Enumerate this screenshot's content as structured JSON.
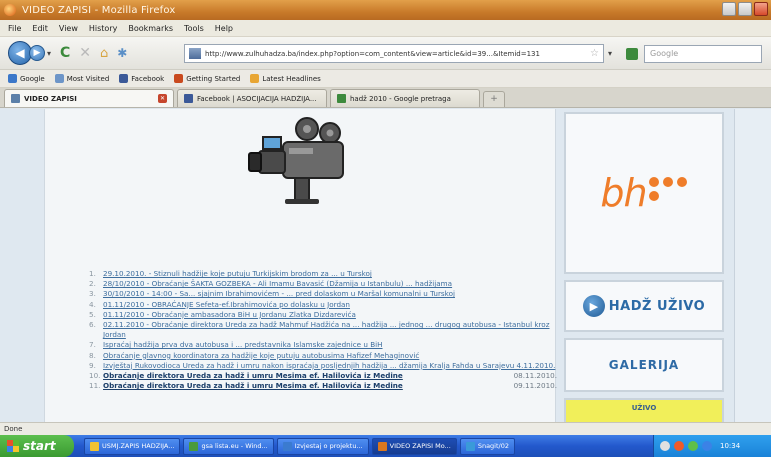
{
  "window": {
    "title": "VIDEO ZAPISI - Mozilla Firefox"
  },
  "menu": [
    "File",
    "Edit",
    "View",
    "History",
    "Bookmarks",
    "Tools",
    "Help"
  ],
  "nav": {
    "url": "http://www.zulhuhadza.ba/index.php?option=com_content&view=article&id=39...&Itemid=131",
    "search_placeholder": "Google"
  },
  "bookmarks": [
    {
      "label": "Google",
      "color": "#3b77c9"
    },
    {
      "label": "Most Visited",
      "color": "#6d95c8"
    },
    {
      "label": "Facebook",
      "color": "#3b5998"
    },
    {
      "label": "Getting Started",
      "color": "#c94a1f"
    },
    {
      "label": "Latest Headlines",
      "color": "#e8a634"
    }
  ],
  "tabs": [
    {
      "label": "VIDEO ZAPISI",
      "active": true,
      "color": "#5b7fa8"
    },
    {
      "label": "Facebook | ASOCIJACIJA HADŽIJA...",
      "active": false,
      "color": "#3b5998"
    },
    {
      "label": "hadž 2010 - Google pretraga",
      "active": false,
      "color": "#3d8a3d"
    }
  ],
  "news": [
    {
      "num": "1.",
      "text": "29.10.2010. - Stiznuli hadžije koje putuju Turkijskim brodom za ... u Turskoj",
      "bold": false,
      "date": ""
    },
    {
      "num": "2.",
      "text": "28/10/2010 - Obraćanje ŠAKTA GOZBEKA - Ali Imamu Bavasić (Džamija u Istanbulu) ... hadžijama",
      "bold": false,
      "date": ""
    },
    {
      "num": "3.",
      "text": "30/10/2010 - 14:00 - Sa... sjajnim Ibrahimovićem - ... pred dolaskom u Maršal komunalni u Turskoj",
      "bold": false,
      "date": ""
    },
    {
      "num": "4.",
      "text": "01.11/2010 - OBRAĆANJE Sefeta-ef.Ibrahimovića po dolasku u Jordan",
      "bold": false,
      "date": ""
    },
    {
      "num": "5.",
      "text": "01.11/2010 - Obraćanje ambasadora BiH u Jordanu Zlatka Dizdarevića",
      "bold": false,
      "date": ""
    },
    {
      "num": "6.",
      "text": "02.11.2010 - Obraćanje direktora Ureda za hadž Mahmuf Hadžića na ... hadžija ... jednog ... drugog autobusa - Istanbul kroz Jordan",
      "bold": false,
      "date": ""
    },
    {
      "num": "7.",
      "text": "Ispraćaj hadžija prva dva autobusa i ... predstavnika Islamske zajednice u BiH",
      "bold": false,
      "date": ""
    },
    {
      "num": "8.",
      "text": "Obraćanje glavnog koordinatora za hadžije koje putuju autobusima Hafizef Mehaginović",
      "bold": false,
      "date": ""
    },
    {
      "num": "9.",
      "text": "Izvještaj Rukovodioca Ureda za hadž i umru nakon ispraćaja posljednjih hadžija ... džamija Kralja Fahda u Sarajevu 4.11.2010.",
      "bold": false,
      "date": ""
    },
    {
      "num": "10.",
      "text": "Obraćanje direktora Ureda za hadž i umru Mesima ef. Halilovića iz Medine",
      "bold": true,
      "date": "08.11.2010."
    },
    {
      "num": "11.",
      "text": "Obraćanje direktora Ureda za hadž i umru Mesima ef. Halilovića iz Medine",
      "bold": true,
      "date": "09.11.2010."
    }
  ],
  "sidebar": {
    "bh_text": "bh",
    "hadz_label": "HADŽ UŽIVO",
    "galerija_label": "GALERIJA",
    "live_label": "UŽIVO"
  },
  "status": "Done",
  "taskbar": {
    "start": "start",
    "items": [
      {
        "label": "USMJ.ZAPIS HADZIJA...",
        "color": "#f1c232",
        "active": false
      },
      {
        "label": "gsa lista.eu - Wind...",
        "color": "#4a9a3c",
        "active": false
      },
      {
        "label": "Izvjestaj o projektu...",
        "color": "#3b7bd0",
        "active": false
      },
      {
        "label": "VIDEO ZAPISI Mo...",
        "color": "#d9771f",
        "active": true
      },
      {
        "label": "Snagit/02",
        "color": "#3a9ad9",
        "active": false
      }
    ],
    "clock": "10:34"
  }
}
